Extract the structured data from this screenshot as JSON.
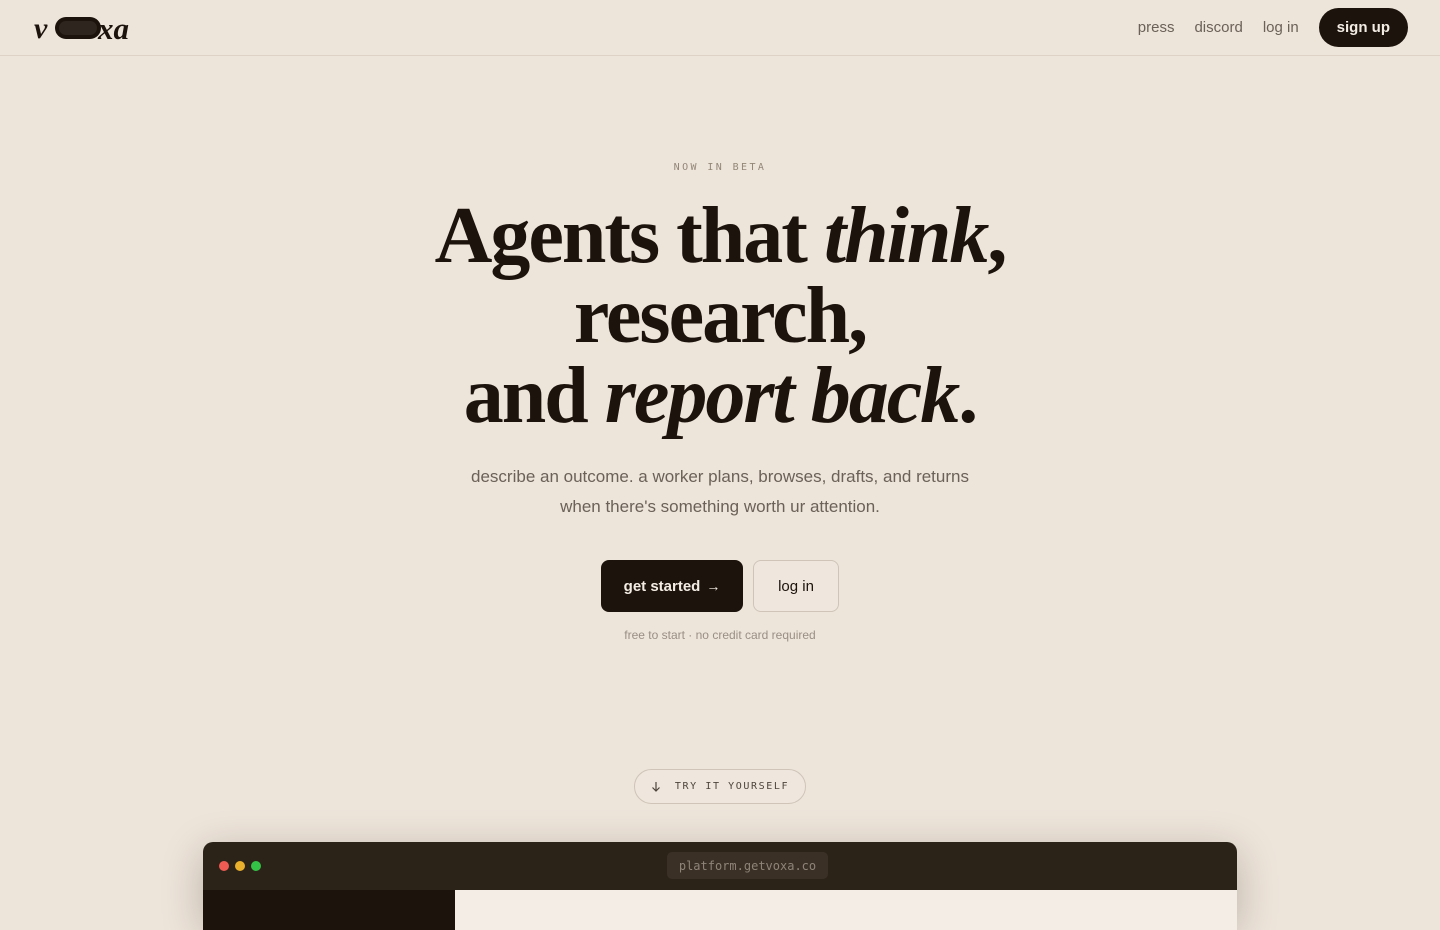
{
  "nav": {
    "links": [
      "press",
      "discord",
      "log in"
    ],
    "signup_label": "sign up"
  },
  "hero": {
    "eyebrow": "NOW IN BETA",
    "headline": {
      "line1_plain": "Agents that ",
      "line1_italic": "think",
      "line1_end": ",",
      "line2": "research,",
      "line3_plain": "and ",
      "line3_italic": "report back",
      "line3_end": "."
    },
    "subtitle": {
      "line1": "describe an outcome. a worker plans, browses, drafts, and returns",
      "line2": "when there's something worth ur attention."
    },
    "primary_cta": "get started",
    "primary_cta_arrow": "→",
    "secondary_cta": "log in",
    "fineprint": "free to start · no credit card required"
  },
  "try": {
    "icon": "arrow-down-icon",
    "label": "TRY IT YOURSELF"
  },
  "preview": {
    "url": "platform.getvoxa.co"
  },
  "colors": {
    "background": "#ede4da",
    "ink": "#1c140c",
    "muted": "#6b6158",
    "window_chrome": "#2b2218"
  }
}
